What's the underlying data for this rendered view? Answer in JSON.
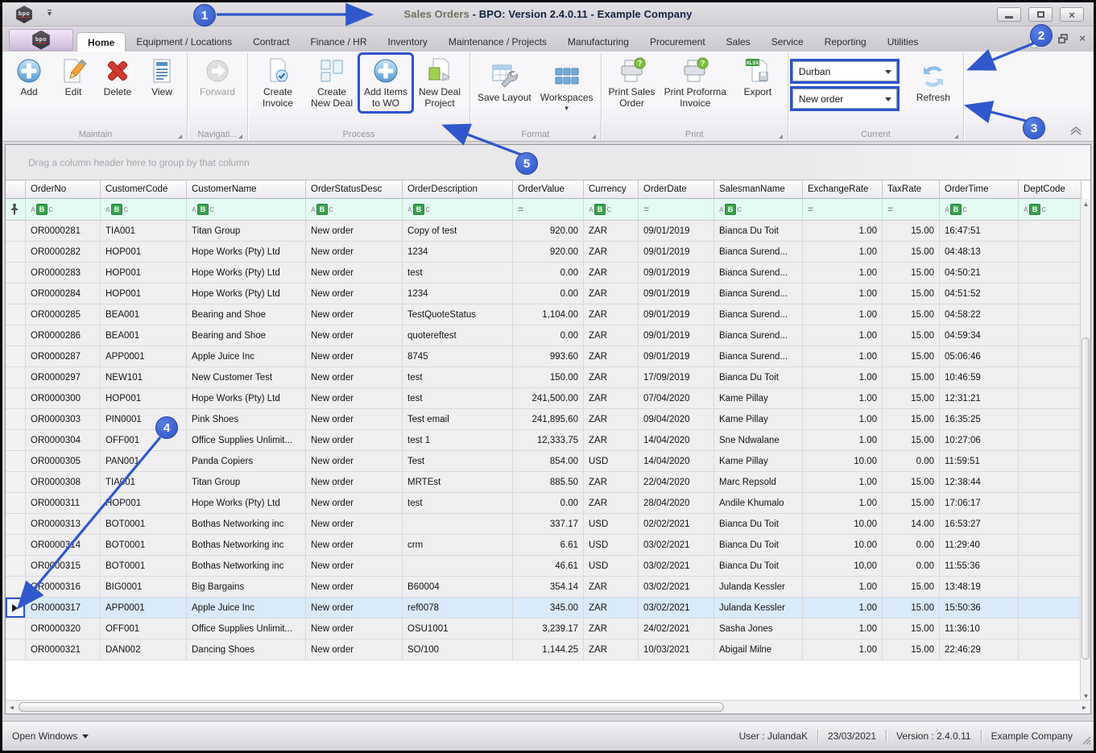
{
  "window": {
    "logo_text": "bpo",
    "title_prefix": "Sales Orders",
    "title_rest": " - BPO: Version 2.4.0.11 - Example Company"
  },
  "tabs": {
    "items": [
      {
        "label": "Home",
        "active": true
      },
      {
        "label": "Equipment / Locations"
      },
      {
        "label": "Contract"
      },
      {
        "label": "Finance / HR"
      },
      {
        "label": "Inventory"
      },
      {
        "label": "Maintenance / Projects"
      },
      {
        "label": "Manufacturing"
      },
      {
        "label": "Procurement"
      },
      {
        "label": "Sales"
      },
      {
        "label": "Service"
      },
      {
        "label": "Reporting"
      },
      {
        "label": "Utilities",
        "clipped": true
      }
    ]
  },
  "ribbon": {
    "groups": [
      {
        "label": "Maintain",
        "buttons": [
          {
            "label": "Add",
            "icon": "add-plus-circle"
          },
          {
            "label": "Edit",
            "icon": "edit-pencil"
          },
          {
            "label": "Delete",
            "icon": "delete-x"
          },
          {
            "label": "View",
            "icon": "view-document"
          }
        ]
      },
      {
        "label": "Navigati...",
        "buttons": [
          {
            "label": "Forward",
            "icon": "forward-arrow",
            "disabled": true,
            "wide": true
          }
        ]
      },
      {
        "label": "Process",
        "buttons": [
          {
            "label": "Create\nInvoice",
            "icon": "create-invoice",
            "wide": true
          },
          {
            "label": "Create\nNew Deal",
            "icon": "create-new-deal",
            "wide": true
          },
          {
            "label": "Add Items\nto WO",
            "icon": "add-plus-circle",
            "wide": true,
            "highlighted": true
          },
          {
            "label": "New Deal\nProject",
            "icon": "new-deal-project",
            "wide": true
          }
        ]
      },
      {
        "label": "Format",
        "buttons": [
          {
            "label": "Save Layout",
            "icon": "save-layout-wrench",
            "wide": true,
            "pad": true
          },
          {
            "label": "Workspaces",
            "icon": "workspaces-grid",
            "wide": true,
            "pad": true,
            "caret": true
          }
        ]
      },
      {
        "label": "Print",
        "buttons": [
          {
            "label": "Print Sales\nOrder",
            "icon": "printer-question",
            "wide": true
          },
          {
            "label": "Print Proforma\nInvoice",
            "icon": "printer-question",
            "wide": true
          },
          {
            "label": "Export",
            "icon": "export-xlsx",
            "wide": true
          }
        ]
      },
      {
        "label": "Current",
        "combos": [
          {
            "value": "Durban",
            "highlighted": true,
            "name": "branch-combo"
          },
          {
            "value": "New order",
            "highlighted": true,
            "name": "order-status-combo"
          }
        ],
        "buttons": [
          {
            "label": "Refresh",
            "icon": "refresh-arrows",
            "wide": true,
            "pad": true
          }
        ]
      }
    ]
  },
  "grid": {
    "group_panel_text": "Drag a column header here to group by that column",
    "filter_icons": {
      "text_abc": [
        "A",
        "B",
        "C"
      ],
      "numeric": "="
    },
    "columns": [
      {
        "label": "OrderNo",
        "filter": "abc"
      },
      {
        "label": "CustomerCode",
        "filter": "abc"
      },
      {
        "label": "CustomerName",
        "filter": "abc"
      },
      {
        "label": "OrderStatusDesc",
        "filter": "abc"
      },
      {
        "label": "OrderDescription",
        "filter": "abc"
      },
      {
        "label": "OrderValue",
        "filter": "eq",
        "align": "right"
      },
      {
        "label": "Currency",
        "filter": "abc"
      },
      {
        "label": "OrderDate",
        "filter": "eq"
      },
      {
        "label": "SalesmanName",
        "filter": "abc"
      },
      {
        "label": "ExchangeRate",
        "filter": "eq",
        "align": "right"
      },
      {
        "label": "TaxRate",
        "filter": "eq",
        "align": "right"
      },
      {
        "label": "OrderTime",
        "filter": "abc"
      },
      {
        "label": "DeptCode",
        "filter": "abc"
      }
    ],
    "selected_index": 18,
    "rows": [
      [
        "OR0000281",
        "TIA001",
        "Titan Group",
        "New order",
        "Copy of test",
        "920.00",
        "ZAR",
        "09/01/2019",
        "Bianca Du Toit",
        "1.00",
        "15.00",
        "16:47:51",
        ""
      ],
      [
        "OR0000282",
        "HOP001",
        "Hope Works (Pty) Ltd",
        "New order",
        "1234",
        "920.00",
        "ZAR",
        "09/01/2019",
        "Bianca Surend...",
        "1.00",
        "15.00",
        "04:48:13",
        ""
      ],
      [
        "OR0000283",
        "HOP001",
        "Hope Works (Pty) Ltd",
        "New order",
        "test",
        "0.00",
        "ZAR",
        "09/01/2019",
        "Bianca Surend...",
        "1.00",
        "15.00",
        "04:50:21",
        ""
      ],
      [
        "OR0000284",
        "HOP001",
        "Hope Works (Pty) Ltd",
        "New order",
        "1234",
        "0.00",
        "ZAR",
        "09/01/2019",
        "Bianca Surend...",
        "1.00",
        "15.00",
        "04:51:52",
        ""
      ],
      [
        "OR0000285",
        "BEA001",
        "Bearing and Shoe",
        "New order",
        "TestQuoteStatus",
        "1,104.00",
        "ZAR",
        "09/01/2019",
        "Bianca Surend...",
        "1.00",
        "15.00",
        "04:58:22",
        ""
      ],
      [
        "OR0000286",
        "BEA001",
        "Bearing and Shoe",
        "New order",
        "quotereftest",
        "0.00",
        "ZAR",
        "09/01/2019",
        "Bianca Surend...",
        "1.00",
        "15.00",
        "04:59:34",
        ""
      ],
      [
        "OR0000287",
        "APP0001",
        "Apple Juice Inc",
        "New order",
        "8745",
        "993.60",
        "ZAR",
        "09/01/2019",
        "Bianca Surend...",
        "1.00",
        "15.00",
        "05:06:46",
        ""
      ],
      [
        "OR0000297",
        "NEW101",
        "New Customer Test",
        "New order",
        "test",
        "150.00",
        "ZAR",
        "17/09/2019",
        "Bianca Du Toit",
        "1.00",
        "15.00",
        "10:46:59",
        ""
      ],
      [
        "OR0000300",
        "HOP001",
        "Hope Works (Pty) Ltd",
        "New order",
        "test",
        "241,500.00",
        "ZAR",
        "07/04/2020",
        "Kame Pillay",
        "1.00",
        "15.00",
        "12:31:21",
        ""
      ],
      [
        "OR0000303",
        "PIN0001",
        "Pink Shoes",
        "New order",
        "Test email",
        "241,895.60",
        "ZAR",
        "09/04/2020",
        "Kame Pillay",
        "1.00",
        "15.00",
        "16:35:25",
        ""
      ],
      [
        "OR0000304",
        "OFF001",
        "Office Supplies Unlimit...",
        "New order",
        "test 1",
        "12,333.75",
        "ZAR",
        "14/04/2020",
        "Sne Ndwalane",
        "1.00",
        "15.00",
        "10:27:06",
        ""
      ],
      [
        "OR0000305",
        "PAN001",
        "Panda Copiers",
        "New order",
        "Test",
        "854.00",
        "USD",
        "14/04/2020",
        "Kame Pillay",
        "10.00",
        "0.00",
        "11:59:51",
        ""
      ],
      [
        "OR0000308",
        "TIA001",
        "Titan Group",
        "New order",
        "MRTEst",
        "885.50",
        "ZAR",
        "22/04/2020",
        "Marc Repsold",
        "1.00",
        "15.00",
        "12:38:44",
        ""
      ],
      [
        "OR0000311",
        "HOP001",
        "Hope Works (Pty) Ltd",
        "New order",
        "test",
        "0.00",
        "ZAR",
        "28/04/2020",
        "Andile Khumalo",
        "1.00",
        "15.00",
        "17:06:17",
        ""
      ],
      [
        "OR0000313",
        "BOT0001",
        "Bothas Networking inc",
        "New order",
        "",
        "337.17",
        "USD",
        "02/02/2021",
        "Bianca Du Toit",
        "10.00",
        "14.00",
        "16:53:27",
        ""
      ],
      [
        "OR0000314",
        "BOT0001",
        "Bothas Networking inc",
        "New order",
        "crm",
        "6.61",
        "USD",
        "03/02/2021",
        "Bianca Du Toit",
        "10.00",
        "0.00",
        "11:29:40",
        ""
      ],
      [
        "OR0000315",
        "BOT0001",
        "Bothas Networking inc",
        "New order",
        "",
        "46.61",
        "USD",
        "03/02/2021",
        "Bianca Du Toit",
        "10.00",
        "0.00",
        "11:55:36",
        ""
      ],
      [
        "OR0000316",
        "BIG0001",
        "Big Bargains",
        "New order",
        "B60004",
        "354.14",
        "ZAR",
        "03/02/2021",
        "Julanda Kessler",
        "1.00",
        "15.00",
        "13:48:19",
        ""
      ],
      [
        "OR0000317",
        "APP0001",
        "Apple Juice Inc",
        "New order",
        "ref0078",
        "345.00",
        "ZAR",
        "03/02/2021",
        "Julanda Kessler",
        "1.00",
        "15.00",
        "15:50:36",
        ""
      ],
      [
        "OR0000320",
        "OFF001",
        "Office Supplies Unlimit...",
        "New order",
        "OSU1001",
        "3,239.17",
        "ZAR",
        "24/02/2021",
        "Sasha Jones",
        "1.00",
        "15.00",
        "11:36:10",
        ""
      ],
      [
        "OR0000321",
        "DAN002",
        "Dancing Shoes",
        "New order",
        "SO/100",
        "1,144.25",
        "ZAR",
        "10/03/2021",
        "Abigail Milne",
        "1.00",
        "15.00",
        "22:46:29",
        ""
      ]
    ]
  },
  "status_bar": {
    "open_windows_label": "Open Windows",
    "right_items": [
      "User : JulandaK",
      "23/03/2021",
      "Version : 2.4.0.11",
      "Example Company"
    ]
  },
  "callouts": {
    "items": [
      "1",
      "2",
      "3",
      "4",
      "5"
    ]
  },
  "colors": {
    "callout_blue": "#2d54ce",
    "highlight_box_blue": "#2d54ce",
    "filter_row_bg": "#e4fbf3",
    "selected_row_bg": "#d9eafa",
    "abc_icon_green": "#3aa14c"
  }
}
